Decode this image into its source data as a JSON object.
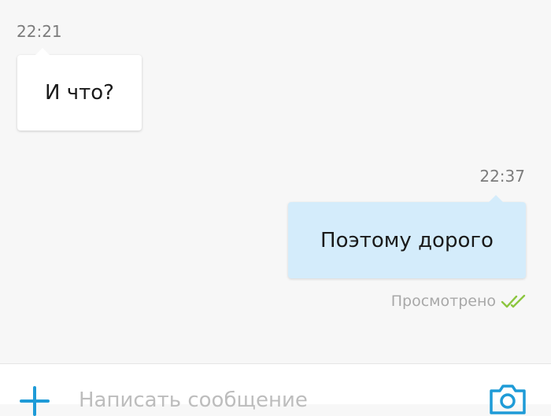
{
  "messages": [
    {
      "direction": "incoming",
      "time": "22:21",
      "text": "И что?"
    },
    {
      "direction": "outgoing",
      "time": "22:37",
      "text": "Поэтому дорого",
      "status": "Просмотрено"
    }
  ],
  "composer": {
    "placeholder": "Написать сообщение",
    "attach_icon": "plus-icon",
    "camera_icon": "camera-icon"
  },
  "colors": {
    "background": "#f7f7f7",
    "incoming_bubble": "#ffffff",
    "outgoing_bubble": "#d4ecfb",
    "accent": "#1e9bd7",
    "read_check": "#8cc63f"
  }
}
